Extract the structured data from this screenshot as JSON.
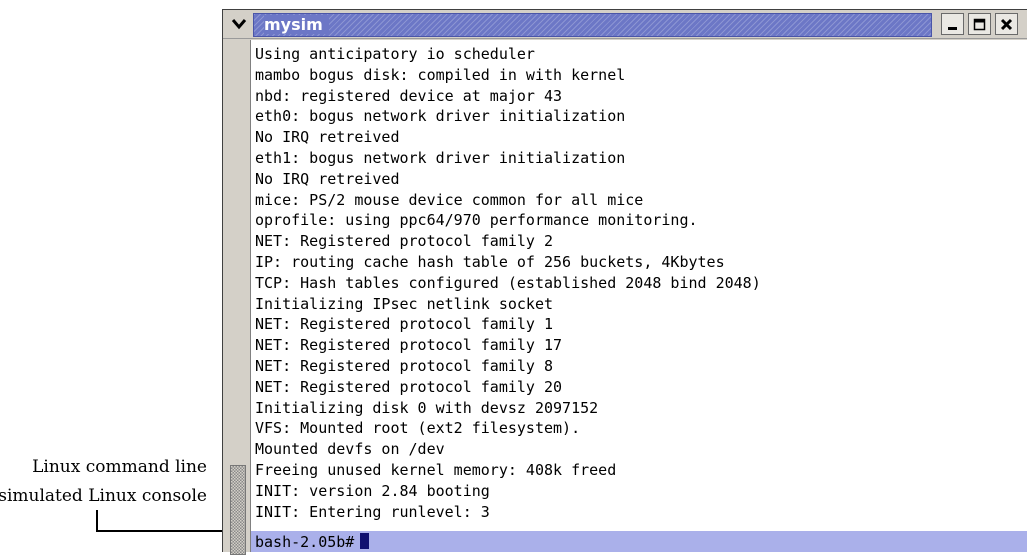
{
  "annotation": {
    "line1": "Linux command line",
    "line2": "simulated Linux console"
  },
  "window": {
    "title": "mysim",
    "accent_color": "#6c77c6",
    "icons": {
      "menu": "chevron-down-icon",
      "minimize": "minimize-icon",
      "maximize": "maximize-icon",
      "close": "close-icon"
    }
  },
  "terminal": {
    "lines": [
      "Using anticipatory io scheduler",
      "mambo bogus disk: compiled in with kernel",
      "nbd: registered device at major 43",
      "eth0: bogus network driver initialization",
      "No IRQ retreived",
      "eth1: bogus network driver initialization",
      "No IRQ retreived",
      "mice: PS/2 mouse device common for all mice",
      "oprofile: using ppc64/970 performance monitoring.",
      "NET: Registered protocol family 2",
      "IP: routing cache hash table of 256 buckets, 4Kbytes",
      "TCP: Hash tables configured (established 2048 bind 2048)",
      "Initializing IPsec netlink socket",
      "NET: Registered protocol family 1",
      "NET: Registered protocol family 17",
      "NET: Registered protocol family 8",
      "NET: Registered protocol family 20",
      "Initializing disk 0 with devsz 2097152",
      "VFS: Mounted root (ext2 filesystem).",
      "Mounted devfs on /dev",
      "Freeing unused kernel memory: 408k freed",
      "INIT: version 2.84 booting",
      "INIT: Entering runlevel: 3"
    ],
    "prompt": "bash-2.05b#",
    "prompt_highlight_color": "#aab0ea"
  }
}
